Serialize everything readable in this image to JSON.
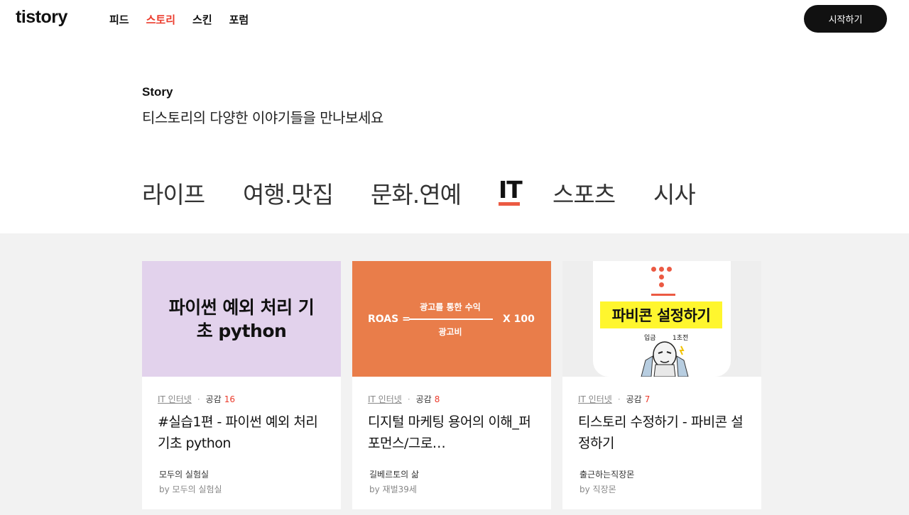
{
  "header": {
    "logo": "tistory",
    "nav": [
      {
        "label": "피드",
        "active": false
      },
      {
        "label": "스토리",
        "active": true
      },
      {
        "label": "스킨",
        "active": false
      },
      {
        "label": "포럼",
        "active": false
      }
    ],
    "start_button": "시작하기",
    "accent_color": "#eb3b2c"
  },
  "intro": {
    "label": "Story",
    "description": "티스토리의 다양한 이야기들을 만나보세요"
  },
  "categories": [
    {
      "label": "라이프",
      "active": false
    },
    {
      "label": "여행.맛집",
      "active": false
    },
    {
      "label": "문화.연예",
      "active": false
    },
    {
      "label": "IT",
      "active": true
    },
    {
      "label": "스포츠",
      "active": false
    },
    {
      "label": "시사",
      "active": false
    }
  ],
  "cards": [
    {
      "thumb_text": "파이썬 예외 처리 기\n초 python",
      "category": "IT 인터넷",
      "likes_label": "공감",
      "likes": "16",
      "title": "#실습1편 - 파이썬 예외 처리 기초 python",
      "blog": "모두의 실험실",
      "author": "by 모두의 실험실"
    },
    {
      "thumb_roas": "ROAS =",
      "thumb_numerator": "광고를 통한 수익",
      "thumb_denominator": "광고비",
      "thumb_times": "X  100",
      "category": "IT 인터넷",
      "likes_label": "공감",
      "likes": "8",
      "title": "디지털 마케팅 용어의 이해_퍼포먼스/그로…",
      "blog": "길베르토의 삶",
      "author": "by 재벌39세"
    },
    {
      "thumb_banner": "파비콘 설정하기",
      "thumb_small1": "입금",
      "thumb_small2": "1초전",
      "category": "IT 인터넷",
      "likes_label": "공감",
      "likes": "7",
      "title": "티스토리 수정하기 - 파비콘 설정하기",
      "blog": "출근하는직장몬",
      "author": "by 직장몬"
    }
  ]
}
